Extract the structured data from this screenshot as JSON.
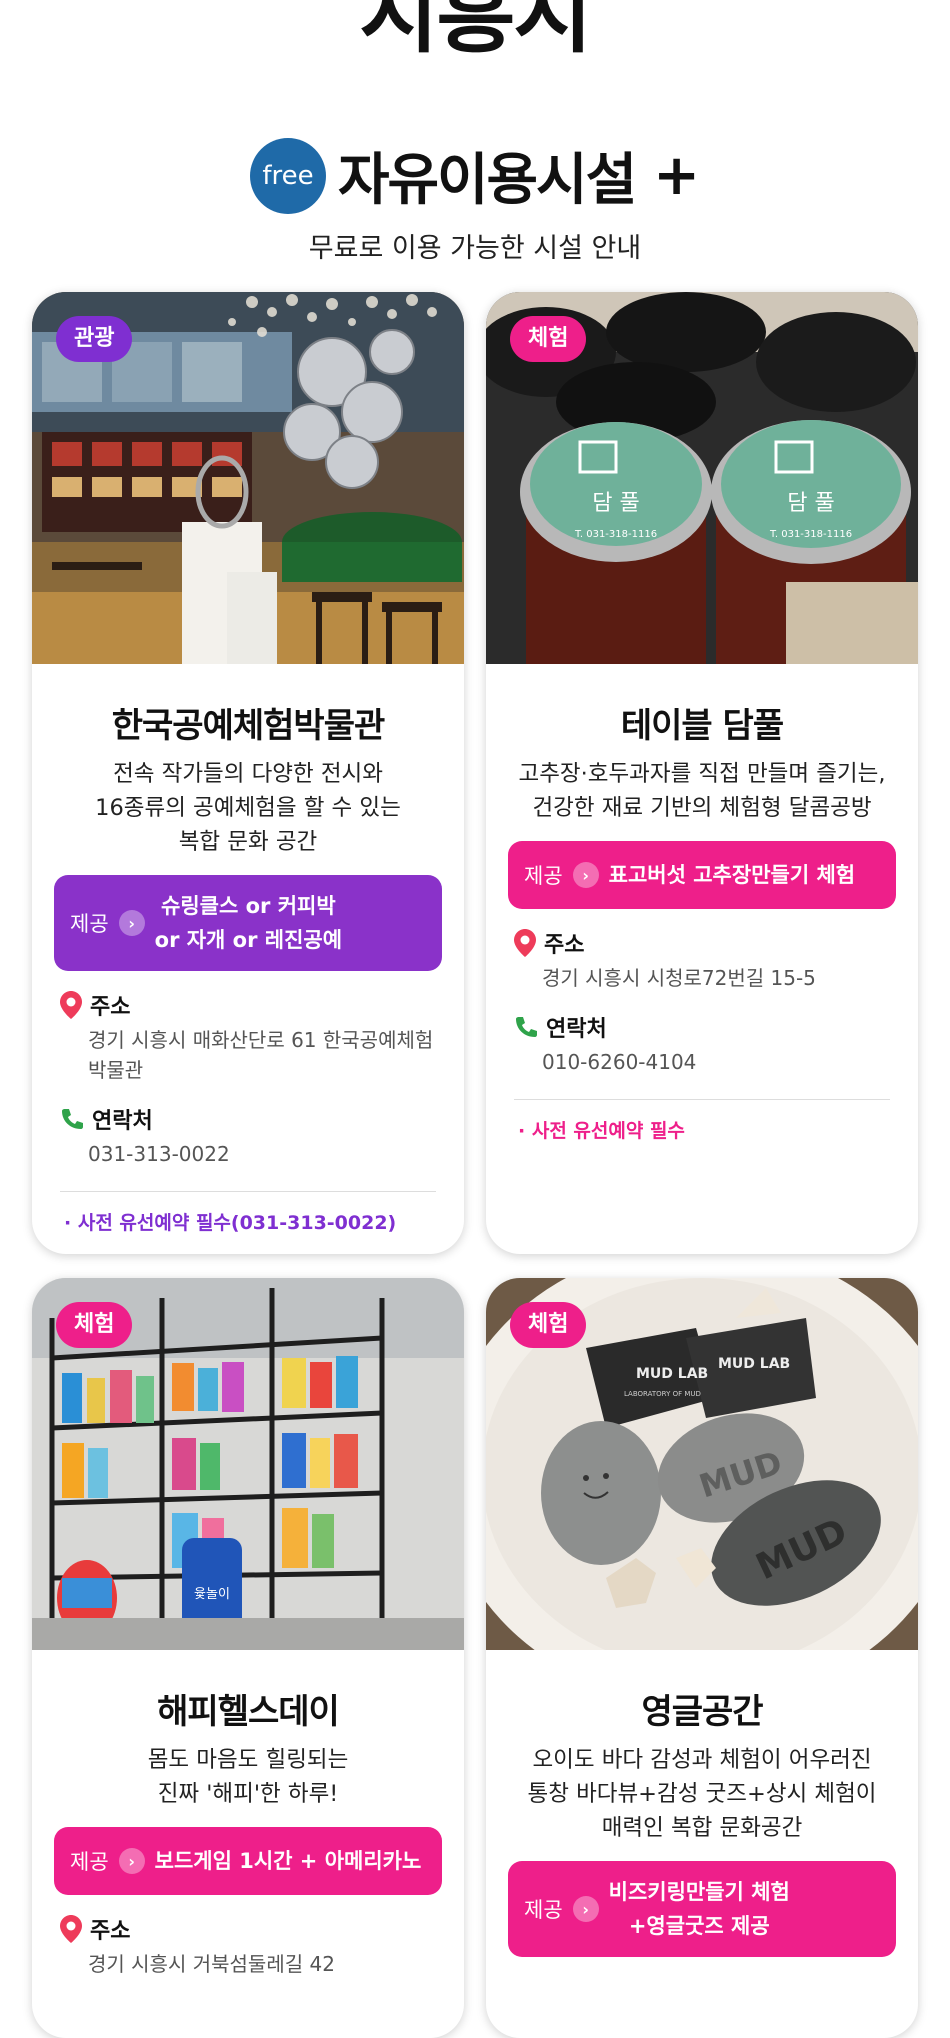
{
  "city": {
    "title": "시흥시"
  },
  "header": {
    "free_badge": "free",
    "title": "자유이용시설",
    "plus": "+",
    "subtitle": "무료로 이용 가능한 시설 안내"
  },
  "cards": [
    {
      "badge": "관광",
      "name": "한국공예체험박물관",
      "description": "전속 작가들의 다양한 전시와\n16종류의 공예체험을 할 수 있는\n복합 문화 공간",
      "offer_label": "제공",
      "offer_text": "슈링클스 or 커피박\nor 자개 or 레진공예",
      "address_label": "주소",
      "address": "경기 시흥시 매화산단로 61 한국공예체험박물관",
      "contact_label": "연락처",
      "contact": "031-313-0022",
      "note": "· 사전 유선예약 필수(031-313-0022)"
    },
    {
      "badge": "체험",
      "name": "테이블 담풀",
      "description": "고추장·호두과자를 직접 만들며 즐기는,\n건강한 재료 기반의 체험형 달콤공방",
      "offer_label": "제공",
      "offer_text": "표고버섯 고추장만들기 체험",
      "address_label": "주소",
      "address": "경기 시흥시 시청로72번길 15-5",
      "contact_label": "연락처",
      "contact": "010-6260-4104",
      "note": "· 사전 유선예약 필수",
      "jar_label": "담 풀",
      "jar_phone": "T. 031-318-1116"
    },
    {
      "badge": "체험",
      "name": "해피헬스데이",
      "description": "몸도 마음도 힐링되는\n진짜 '해피'한 하루!",
      "offer_label": "제공",
      "offer_text": "보드게임 1시간 + 아메리카노",
      "address_label": "주소",
      "address": "경기 시흥시 거북섬둘레길 42",
      "bag_text": "윷놀이"
    },
    {
      "badge": "체험",
      "name": "영글공간",
      "description": "오이도 바다 감성과 체험이 어우러진\n통창 바다뷰+감성 굿즈+상시 체험이\n매력인 복합 문화공간",
      "offer_label": "제공",
      "offer_text": "비즈키링만들기 체험\n+영글굿즈 제공",
      "soap_text": "MUD LAB",
      "soap_sub": "LABORATORY OF MUD",
      "stone_text": "MUD"
    }
  ],
  "colors": {
    "purple": "#7f2fd1",
    "pink": "#ee1f8a",
    "free_blue": "#1f6aa8"
  }
}
